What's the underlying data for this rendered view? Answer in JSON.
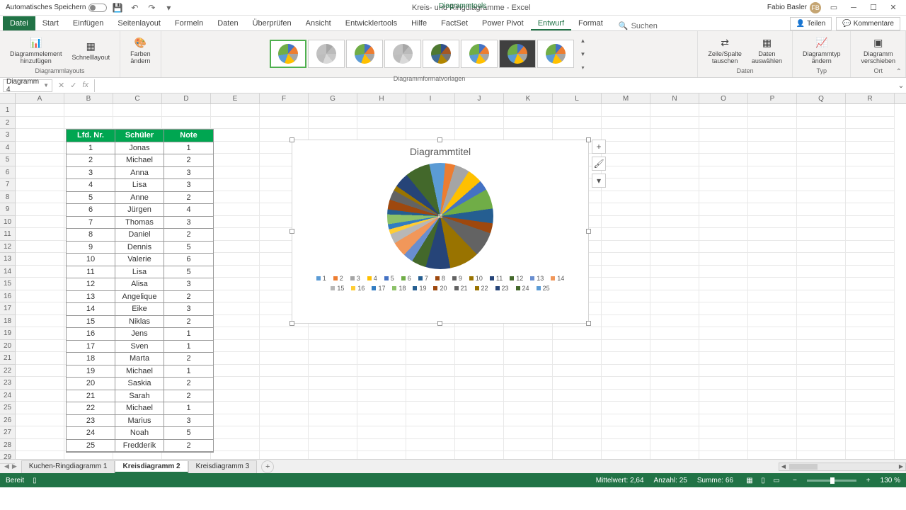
{
  "titlebar": {
    "autosave": "Automatisches Speichern",
    "title": "Kreis- und Ringdiagramme - Excel",
    "tools": "Diagrammtools",
    "user": "Fabio Basler",
    "initials": "FB"
  },
  "tabs": {
    "file": "Datei",
    "list": [
      "Start",
      "Einfügen",
      "Seitenlayout",
      "Formeln",
      "Daten",
      "Überprüfen",
      "Ansicht",
      "Entwicklertools",
      "Hilfe",
      "FactSet",
      "Power Pivot"
    ],
    "context": [
      "Entwurf",
      "Format"
    ],
    "active": "Entwurf",
    "search": "Suchen",
    "share": "Teilen",
    "comments": "Kommentare"
  },
  "ribbon": {
    "add_element": "Diagrammelement\nhinzufügen",
    "quick_layout": "Schnelllayout",
    "change_colors": "Farben\nändern",
    "group_layouts": "Diagrammlayouts",
    "group_styles": "Diagrammformatvorlagen",
    "switch_rc": "Zeile/Spalte\ntauschen",
    "select_data": "Daten\nauswählen",
    "group_data": "Daten",
    "change_type": "Diagrammtyp\nändern",
    "group_type": "Typ",
    "move_chart": "Diagramm\nverschieben",
    "group_loc": "Ort"
  },
  "namebox": "Diagramm 4",
  "columns": [
    "A",
    "B",
    "C",
    "D",
    "E",
    "F",
    "G",
    "H",
    "I",
    "J",
    "K",
    "L",
    "M",
    "N",
    "O",
    "P",
    "Q",
    "R"
  ],
  "headers": {
    "nr": "Lfd. Nr.",
    "schuler": "Schüler",
    "note": "Note"
  },
  "rows": [
    {
      "n": 1,
      "s": "Jonas",
      "g": 1
    },
    {
      "n": 2,
      "s": "Michael",
      "g": 2
    },
    {
      "n": 3,
      "s": "Anna",
      "g": 3
    },
    {
      "n": 4,
      "s": "Lisa",
      "g": 3
    },
    {
      "n": 5,
      "s": "Anne",
      "g": 2
    },
    {
      "n": 6,
      "s": "Jürgen",
      "g": 4
    },
    {
      "n": 7,
      "s": "Thomas",
      "g": 3
    },
    {
      "n": 8,
      "s": "Daniel",
      "g": 2
    },
    {
      "n": 9,
      "s": "Dennis",
      "g": 5
    },
    {
      "n": 10,
      "s": "Valerie",
      "g": 6
    },
    {
      "n": 11,
      "s": "Lisa",
      "g": 5
    },
    {
      "n": 12,
      "s": "Alisa",
      "g": 3
    },
    {
      "n": 13,
      "s": "Angelique",
      "g": 2
    },
    {
      "n": 14,
      "s": "Eike",
      "g": 3
    },
    {
      "n": 15,
      "s": "Niklas",
      "g": 2
    },
    {
      "n": 16,
      "s": "Jens",
      "g": 1
    },
    {
      "n": 17,
      "s": "Sven",
      "g": 1
    },
    {
      "n": 18,
      "s": "Marta",
      "g": 2
    },
    {
      "n": 19,
      "s": "Michael",
      "g": 1
    },
    {
      "n": 20,
      "s": "Saskia",
      "g": 2
    },
    {
      "n": 21,
      "s": "Sarah",
      "g": 2
    },
    {
      "n": 22,
      "s": "Michael",
      "g": 1
    },
    {
      "n": 23,
      "s": "Marius",
      "g": 3
    },
    {
      "n": 24,
      "s": "Noah",
      "g": 5
    },
    {
      "n": 25,
      "s": "Fredderik",
      "g": 2
    }
  ],
  "chart": {
    "title": "Diagrammtitel"
  },
  "chart_data": {
    "type": "pie",
    "title": "Diagrammtitel",
    "categories": [
      1,
      2,
      3,
      4,
      5,
      6,
      7,
      8,
      9,
      10,
      11,
      12,
      13,
      14,
      15,
      16,
      17,
      18,
      19,
      20,
      21,
      22,
      23,
      24,
      25
    ],
    "values": [
      1,
      2,
      3,
      3,
      2,
      4,
      3,
      2,
      5,
      6,
      5,
      3,
      2,
      3,
      2,
      1,
      1,
      2,
      1,
      2,
      2,
      1,
      3,
      5,
      2
    ],
    "legend_position": "bottom"
  },
  "legend_colors": [
    "#5b9bd5",
    "#ed7d31",
    "#a5a5a5",
    "#ffc000",
    "#4472c4",
    "#70ad47",
    "#255e91",
    "#9e480e",
    "#636363",
    "#997300",
    "#264478",
    "#43682b",
    "#698ed0",
    "#f1975a",
    "#b7b7b7",
    "#ffcd33",
    "#327dc2",
    "#8cc168",
    "#255e91",
    "#9e480e",
    "#636363",
    "#997300",
    "#264478",
    "#43682b",
    "#5b9bd5"
  ],
  "sheets": {
    "list": [
      "Kuchen-Ringdiagramm 1",
      "Kreisdiagramm 2",
      "Kreisdiagramm 3"
    ],
    "active": 1
  },
  "status": {
    "ready": "Bereit",
    "avg_label": "Mittelwert:",
    "avg": "2,64",
    "count_label": "Anzahl:",
    "count": "25",
    "sum_label": "Summe:",
    "sum": "66",
    "zoom": "130 %"
  }
}
